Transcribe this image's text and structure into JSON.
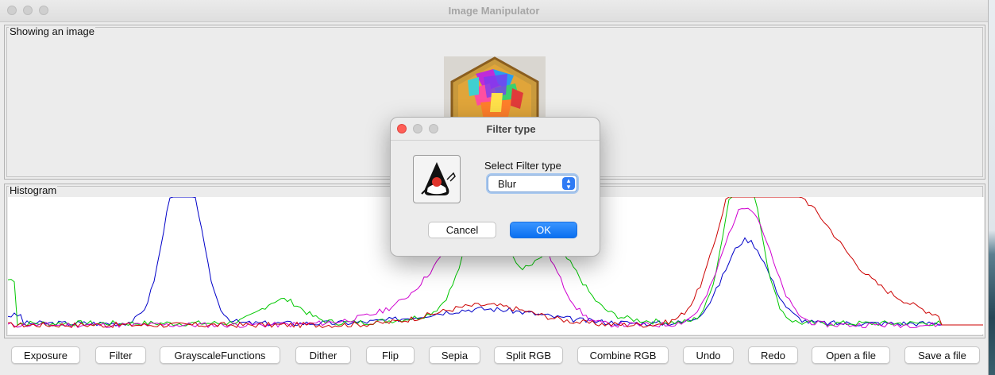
{
  "window": {
    "title": "Image Manipulator"
  },
  "image_panel": {
    "label": "Showing an image"
  },
  "histogram": {
    "label": "Histogram",
    "colors": {
      "red": "#cc0000",
      "green": "#00c800",
      "blue": "#0000c8",
      "magenta": "#d000d0"
    }
  },
  "buttons": [
    {
      "label": "Exposure"
    },
    {
      "label": "Filter"
    },
    {
      "label": "GrayscaleFunctions"
    },
    {
      "label": "Dither"
    },
    {
      "label": "Flip"
    },
    {
      "label": "Sepia"
    },
    {
      "label": "Split RGB"
    },
    {
      "label": "Combine RGB"
    },
    {
      "label": "Undo"
    },
    {
      "label": "Redo"
    },
    {
      "label": "Open a file"
    },
    {
      "label": "Save a file"
    }
  ],
  "dialog": {
    "title": "Filter type",
    "prompt": "Select Filter type",
    "selected": "Blur",
    "cancel_label": "Cancel",
    "ok_label": "OK"
  }
}
